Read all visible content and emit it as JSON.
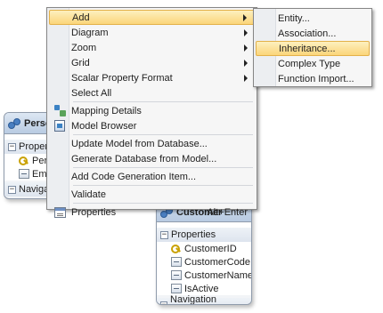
{
  "entities": {
    "person": {
      "title": "Person",
      "properties_header": "Properties",
      "properties": [
        "PersonID",
        "Email"
      ],
      "navigation_header": "Navigation"
    },
    "customer": {
      "title": "Customer",
      "properties_header": "Properties",
      "properties": [
        {
          "name": "CustomerID",
          "key": true
        },
        {
          "name": "CustomerCode",
          "key": false
        },
        {
          "name": "CustomerName",
          "key": false
        },
        {
          "name": "IsActive",
          "key": false
        }
      ],
      "navigation_header": "Navigation Properties"
    }
  },
  "context_menu": {
    "items": [
      {
        "label": "Add",
        "submenu": true,
        "highlighted": true
      },
      {
        "label": "Diagram",
        "submenu": true
      },
      {
        "label": "Zoom",
        "submenu": true
      },
      {
        "label": "Grid",
        "submenu": true
      },
      {
        "label": "Scalar Property Format",
        "submenu": true
      },
      {
        "label": "Select All"
      },
      {
        "label": "Mapping Details",
        "icon": "mapping-details-icon"
      },
      {
        "label": "Model Browser",
        "icon": "model-browser-icon"
      },
      {
        "label": "Update Model from Database..."
      },
      {
        "label": "Generate Database from Model..."
      },
      {
        "label": "Add Code Generation Item..."
      },
      {
        "label": "Validate"
      },
      {
        "label": "Properties",
        "icon": "properties-icon",
        "shortcut": "Alt+Enter"
      }
    ]
  },
  "add_submenu": {
    "items": [
      {
        "label": "Entity..."
      },
      {
        "label": "Association..."
      },
      {
        "label": "Inheritance...",
        "highlighted": true
      },
      {
        "label": "Complex Type"
      },
      {
        "label": "Function Import..."
      }
    ]
  },
  "colors": {
    "highlight": "#fbd57a",
    "menu_background": "#f6f6f6",
    "entity_header": "#b9cbe2"
  }
}
